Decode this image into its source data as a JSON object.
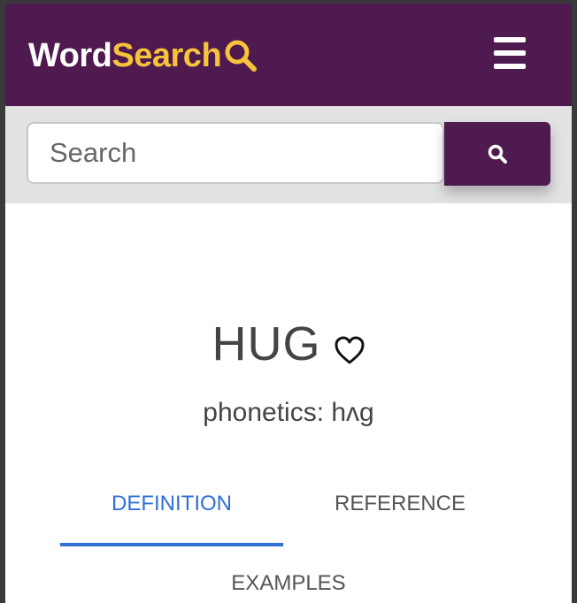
{
  "header": {
    "logo_part1": "Word",
    "logo_part2": "Search",
    "logo_icon": "magnifier-icon",
    "menu_icon": "hamburger-icon"
  },
  "search": {
    "placeholder": "Search",
    "value": "",
    "button_icon": "search-icon"
  },
  "entry": {
    "word": "HUG",
    "favorite_icon": "heart-outline-icon",
    "phonetics": "phonetics: hʌg"
  },
  "tabs": [
    {
      "label": "DEFINITION",
      "active": true
    },
    {
      "label": "REFERENCE",
      "active": false
    },
    {
      "label": "EXAMPLES",
      "active": false
    }
  ],
  "colors": {
    "brand": "#4e1a4f",
    "logo_accent": "#f6c33a",
    "active_tab": "#2f6fd8"
  }
}
